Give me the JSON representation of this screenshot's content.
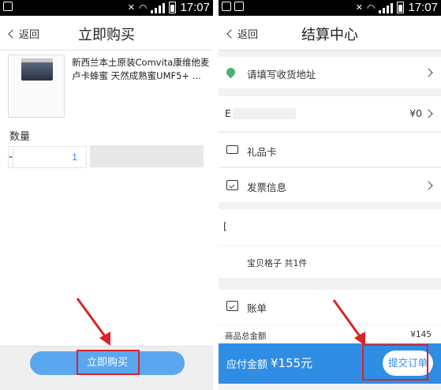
{
  "left_screen": {
    "status_bar": {
      "time": "17:07"
    },
    "nav": {
      "back_label": "返回",
      "title": "立即购买"
    },
    "product": {
      "name": "新西兰本土原装Comvita康维他麦卢卡蜂蜜 天然成熟蜜UMF5+ ..."
    },
    "quantity": {
      "label": "数量",
      "minus_label": "-",
      "value": "1"
    },
    "buy_button": {
      "label": "立即购买"
    }
  },
  "right_screen": {
    "status_bar": {
      "time": "17:07"
    },
    "nav": {
      "back_label": "返回",
      "title": "结算中心"
    },
    "address": {
      "label": "请填写收货地址"
    },
    "coupon": {
      "label": "E",
      "value": "¥0"
    },
    "gift_card": {
      "label": "礼品卡"
    },
    "invoice": {
      "label": "发票信息"
    },
    "shop": {
      "label": "[",
      "items_label": "宝贝格子  共1件"
    },
    "bill": {
      "label": "账单",
      "subtotal_label": "商品总金额",
      "subtotal_value": "¥145"
    },
    "pay_bar": {
      "due_label": "应付金额",
      "due_amount": "¥155元",
      "submit_label": "提交订单"
    }
  },
  "colors": {
    "accent_blue": "#2f8de4",
    "button_blue": "#5aa7f0",
    "highlight_red": "#d9242b",
    "address_green": "#49b36b"
  },
  "icons": [
    "back-chevron-icon",
    "location-pin-icon",
    "gift-card-icon",
    "invoice-icon",
    "bill-icon",
    "chevron-right-icon",
    "red-arrow-icon"
  ]
}
